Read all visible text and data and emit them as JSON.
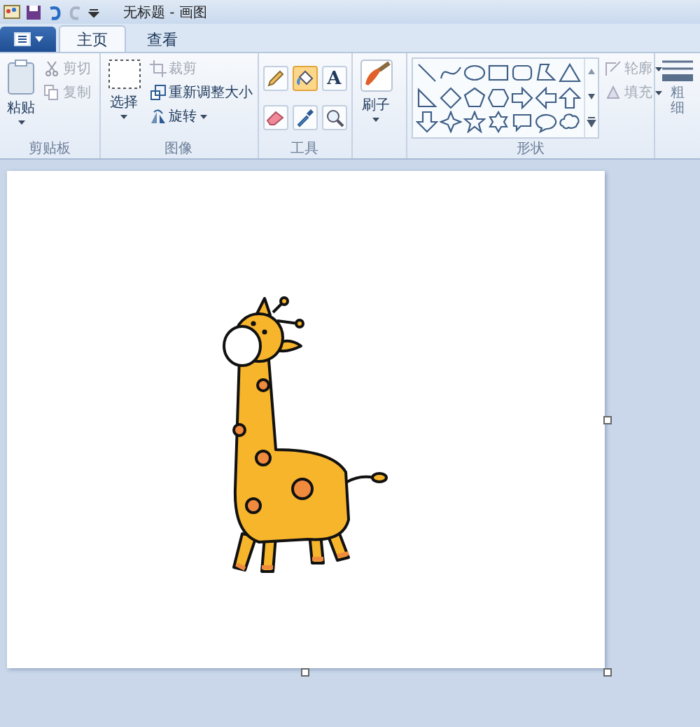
{
  "window": {
    "title": "无标题 - 画图"
  },
  "tabs": [
    {
      "label": "主页",
      "selected": true
    },
    {
      "label": "查看",
      "selected": false
    }
  ],
  "clipboard": {
    "label": "剪贴板",
    "paste": "粘贴",
    "actions": [
      {
        "kind": "cut",
        "label": "剪切",
        "disabled": true
      },
      {
        "kind": "copy",
        "label": "复制",
        "disabled": true
      }
    ]
  },
  "image": {
    "label": "图像",
    "select": "选择",
    "actions": [
      {
        "kind": "crop",
        "label": "裁剪",
        "disabled": true
      },
      {
        "kind": "resize",
        "label": "重新调整大小",
        "disabled": false
      },
      {
        "kind": "rotate",
        "label": "旋转",
        "disabled": false
      }
    ]
  },
  "tools": {
    "label": "工具",
    "items": [
      {
        "kind": "pencil",
        "selected": false
      },
      {
        "kind": "fill",
        "selected": true
      },
      {
        "kind": "text",
        "glyph": "A",
        "selected": false
      },
      {
        "kind": "eraser",
        "selected": false
      },
      {
        "kind": "picker",
        "selected": false
      },
      {
        "kind": "magnifier",
        "selected": false
      }
    ]
  },
  "brushes": {
    "label": "刷子"
  },
  "shapes": {
    "label": "形状",
    "outline": {
      "label": "轮廓",
      "disabled": true
    },
    "fill": {
      "label": "填充",
      "disabled": true
    }
  },
  "size": {
    "label": "粗细"
  }
}
